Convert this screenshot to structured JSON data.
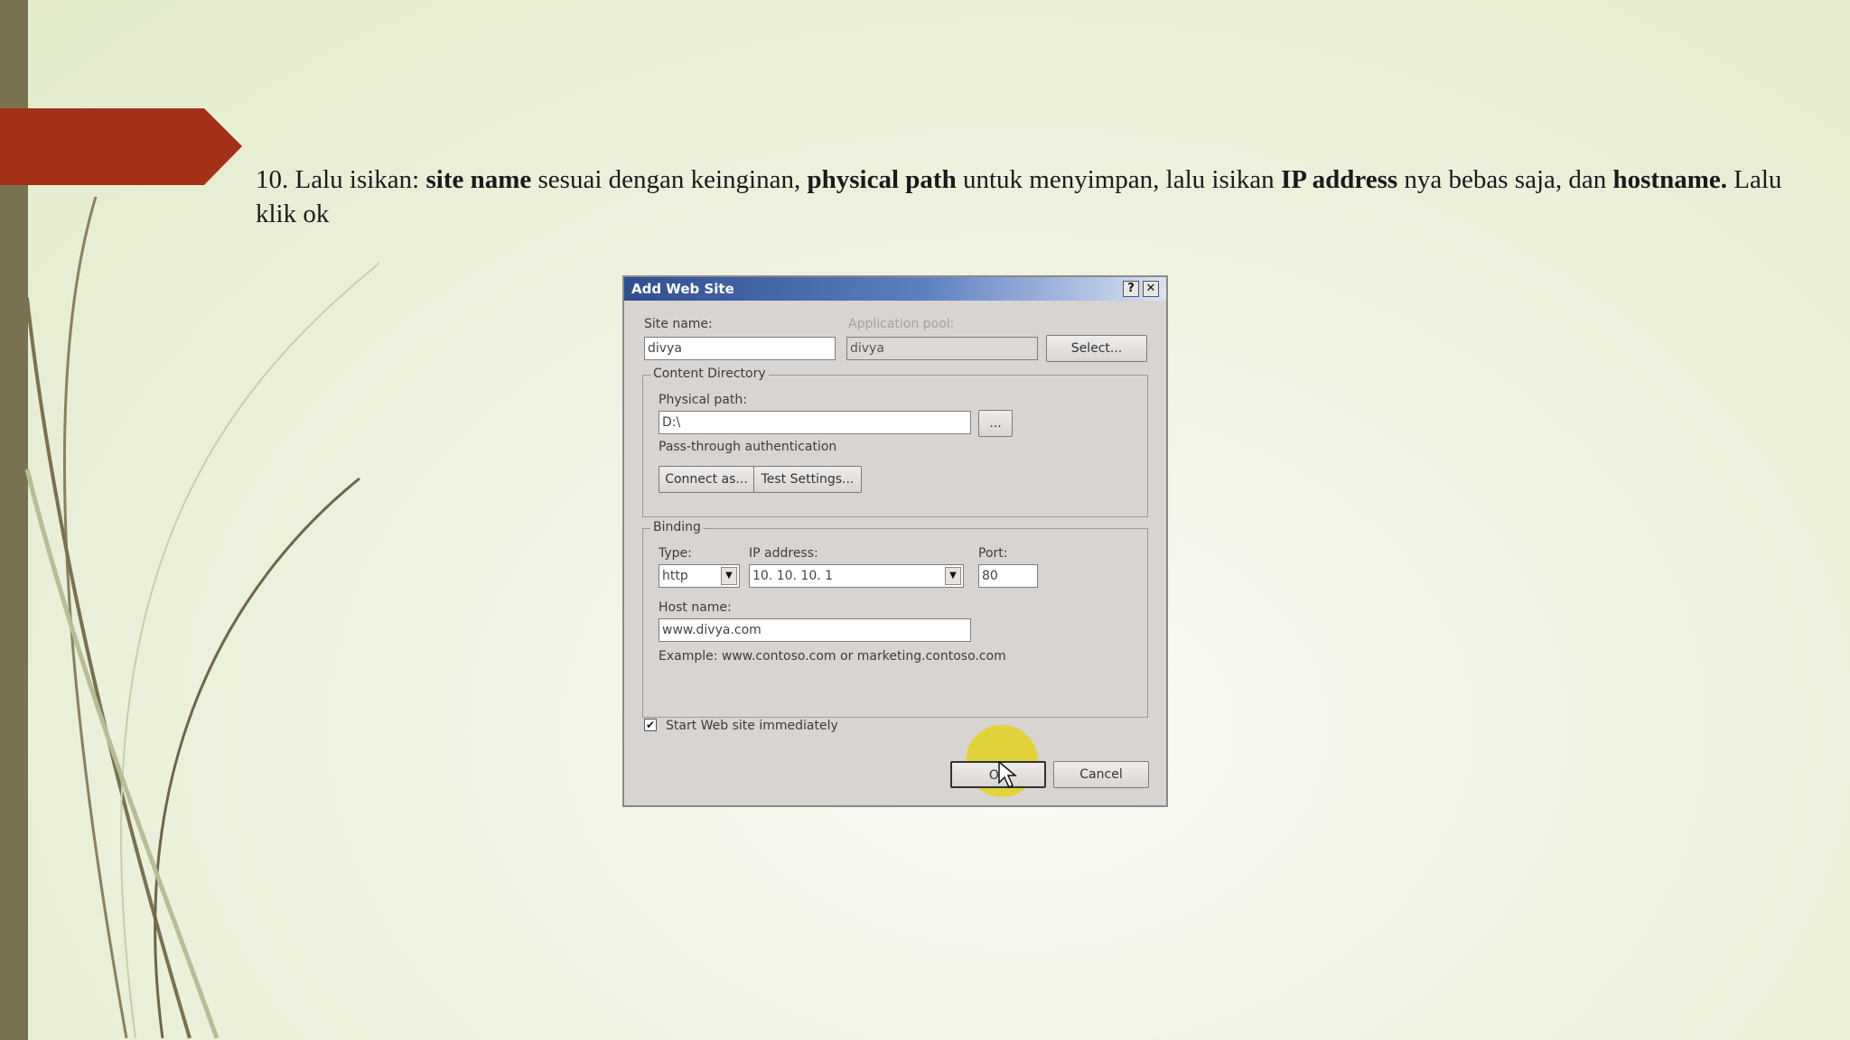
{
  "caption": {
    "p1": "10. Lalu isikan: ",
    "b1": "site name",
    "p2": " sesuai dengan keinginan, ",
    "b2": "physical path",
    "p3": " untuk menyimpan, lalu isikan ",
    "b3": "IP address",
    "p4": " nya bebas saja, dan ",
    "b4": "hostname.",
    "p5": " Lalu klik ok"
  },
  "dialog": {
    "title": "Add Web Site",
    "help_label": "?",
    "close_label": "✕",
    "site_name_label": "Site name:",
    "site_name_value": "divya",
    "app_pool_label": "Application pool:",
    "app_pool_value": "divya",
    "select_label": "Select...",
    "content_dir_label": "Content Directory",
    "physical_path_label": "Physical path:",
    "physical_path_value": "D:\\",
    "browse_label": "...",
    "passthrough_label": "Pass-through authentication",
    "connect_as_label": "Connect as...",
    "test_settings_label": "Test Settings...",
    "binding_label": "Binding",
    "type_label": "Type:",
    "type_value": "http",
    "ip_label": "IP address:",
    "ip_value": "10. 10. 10. 1",
    "port_label": "Port:",
    "port_value": "80",
    "host_label": "Host name:",
    "host_value": "www.divya.com",
    "example_label": "Example: www.contoso.com or marketing.contoso.com",
    "start_label": "Start Web site immediately",
    "start_checked": "✔",
    "ok_label": "OK",
    "cancel_label": "Cancel"
  },
  "colors": {
    "left_bar": "#7a7150",
    "arrow": "#a33018",
    "title_bar": "#2f4f8f",
    "highlight": "#e6d214"
  }
}
